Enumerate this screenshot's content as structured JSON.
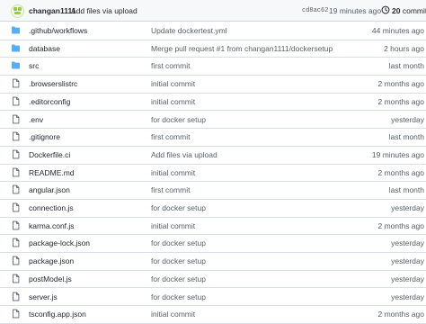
{
  "header": {
    "author": "changan1111",
    "message": "Add files via upload",
    "sha": "cd8ac62",
    "time": "19 minutes ago",
    "commit_count": "20",
    "commits_label": "commits"
  },
  "files": [
    {
      "name": ".github/workflows",
      "type": "folder",
      "message": "Update dockertest.yml",
      "age": "44 minutes ago"
    },
    {
      "name": "database",
      "type": "folder",
      "message": "Merge pull request #1 from changan1111/dockersetup",
      "age": "2 hours ago"
    },
    {
      "name": "src",
      "type": "folder",
      "message": "first commit",
      "age": "last month"
    },
    {
      "name": ".browserslistrc",
      "type": "file",
      "message": "initial commit",
      "age": "2 months ago"
    },
    {
      "name": ".editorconfig",
      "type": "file",
      "message": "initial commit",
      "age": "2 months ago"
    },
    {
      "name": ".env",
      "type": "file",
      "message": "for docker setup",
      "age": "yesterday"
    },
    {
      "name": ".gitignore",
      "type": "file",
      "message": "first commit",
      "age": "last month"
    },
    {
      "name": "Dockerfile.ci",
      "type": "file",
      "message": "Add files via upload",
      "age": "19 minutes ago"
    },
    {
      "name": "README.md",
      "type": "file",
      "message": "initial commit",
      "age": "2 months ago"
    },
    {
      "name": "angular.json",
      "type": "file",
      "message": "first commit",
      "age": "last month"
    },
    {
      "name": "connection.js",
      "type": "file",
      "message": "for docker setup",
      "age": "yesterday"
    },
    {
      "name": "karma.conf.js",
      "type": "file",
      "message": "initial commit",
      "age": "2 months ago"
    },
    {
      "name": "package-lock.json",
      "type": "file",
      "message": "for docker setup",
      "age": "yesterday"
    },
    {
      "name": "package.json",
      "type": "file",
      "message": "for docker setup",
      "age": "yesterday"
    },
    {
      "name": "postModel.js",
      "type": "file",
      "message": "for docker setup",
      "age": "yesterday"
    },
    {
      "name": "server.js",
      "type": "file",
      "message": "for docker setup",
      "age": "yesterday"
    },
    {
      "name": "tsconfig.app.json",
      "type": "file",
      "message": "initial commit",
      "age": "2 months ago"
    }
  ],
  "colors": {
    "folder": "#54aeff",
    "file": "#57606a",
    "link": "#24292f",
    "muted": "#57606a"
  }
}
